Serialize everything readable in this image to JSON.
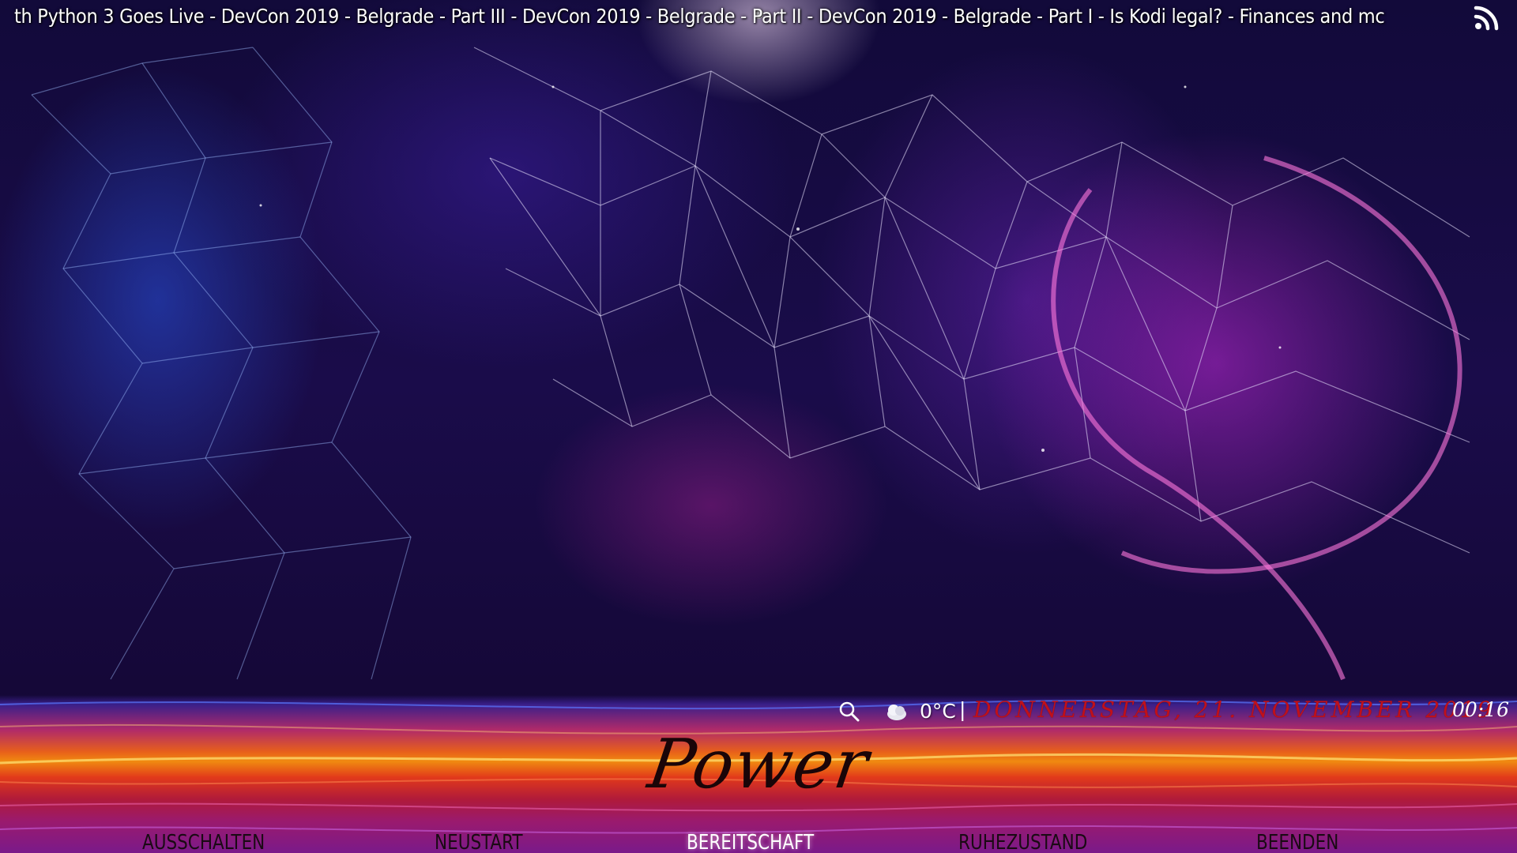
{
  "ticker": {
    "text": "th Python 3 Goes Live - DevCon 2019 - Belgrade - Part III - DevCon 2019 - Belgrade - Part II - DevCon 2019 - Belgrade - Part I - Is Kodi legal? - Finances and mc",
    "icon": "rss-icon"
  },
  "status": {
    "search_icon": "search-icon",
    "weather_icon": "weather-icon",
    "temperature": "0°C",
    "separator": "|",
    "date": "DONNERSTAG, 21. NOVEMBER 2019",
    "time": "00:16"
  },
  "power": {
    "title": "Power",
    "menu": [
      {
        "label": "AUSSCHALTEN",
        "focused": false
      },
      {
        "label": "NEUSTART",
        "focused": false
      },
      {
        "label": "BEREITSCHAFT",
        "focused": true
      },
      {
        "label": "RUHEZUSTAND",
        "focused": false
      },
      {
        "label": "BEENDEN",
        "focused": false
      }
    ]
  },
  "colors": {
    "date": "#c0101a",
    "focused_menu": "#ffffff",
    "menu": "#1a0a14",
    "title": "#1a0508"
  }
}
